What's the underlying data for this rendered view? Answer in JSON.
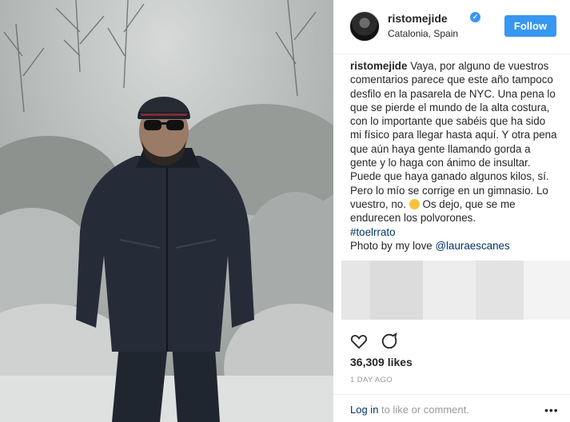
{
  "post": {
    "username": "ristomejide",
    "verified_mark": "✓",
    "location": "Catalonia, Spain",
    "follow_label": "Follow",
    "caption": {
      "username": "ristomejide",
      "text_1": "Vaya, por alguno de vuestros comentarios parece que este año tampoco desfilo en la pasarela de NYC. Una pena lo que se pierde el mundo de la alta costura, con lo importante que sabéis que ha sido mi físico para llegar hasta aquí. Y otra pena que aún haya gente llamando gorda a gente y lo haga con ánimo de insultar. Puede que haya ganado algunos kilos, sí. Pero lo mío se corrige en un gimnasio. Lo vuestro, no.",
      "text_2": "Os dejo, que se me endurecen los polvorones.",
      "hashtag": "#toelrrato",
      "photo_credit_prefix": "Photo by my love ",
      "mention": "@lauraescanes"
    },
    "likes": "36,309 likes",
    "timestamp": "1 DAY AGO",
    "login_link": "Log in",
    "login_rest": " to like or comment.",
    "more_glyph": "•••"
  },
  "icons": {
    "avatar": "avatar",
    "verified": "verified-icon",
    "like": "heart-icon",
    "comment": "comment-icon",
    "emoji": "unamused-face-emoji",
    "more": "more-options-icon"
  },
  "colors": {
    "accent": "#3897f0",
    "link": "#003569",
    "muted": "#999999",
    "text": "#262626"
  }
}
